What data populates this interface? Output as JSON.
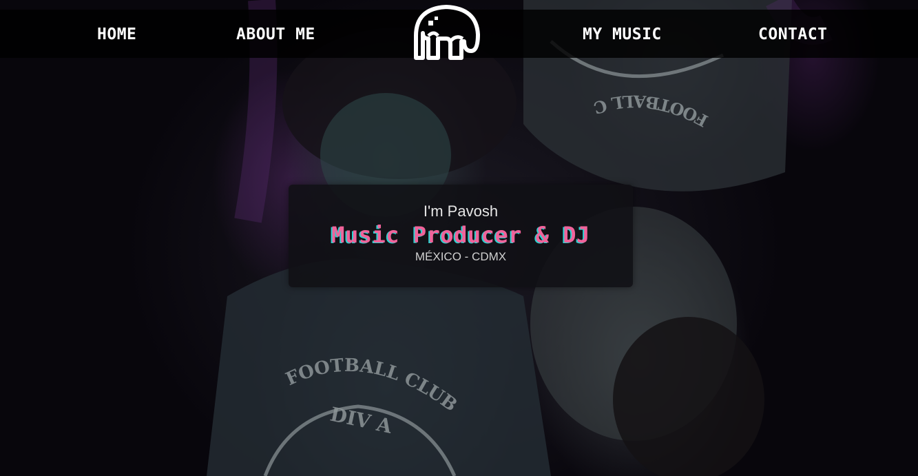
{
  "nav": {
    "home_label": "HOME",
    "about_label": "ABOUT ME",
    "music_label": "MY MUSIC",
    "contact_label": "CONTACT"
  },
  "logo": {
    "icon": "elephant-logo-icon"
  },
  "hero": {
    "greeting": "I'm Pavosh",
    "role": "Music Producer & DJ",
    "location": "MÉXICO - CDMX"
  },
  "background": {
    "shirt_text_1": "FOOTBALL CLUB",
    "shirt_text_2": "DIV A"
  },
  "colors": {
    "accent_pink": "#f0639a",
    "accent_cyan": "#2bd3d0",
    "nav_bg": "#000000"
  }
}
